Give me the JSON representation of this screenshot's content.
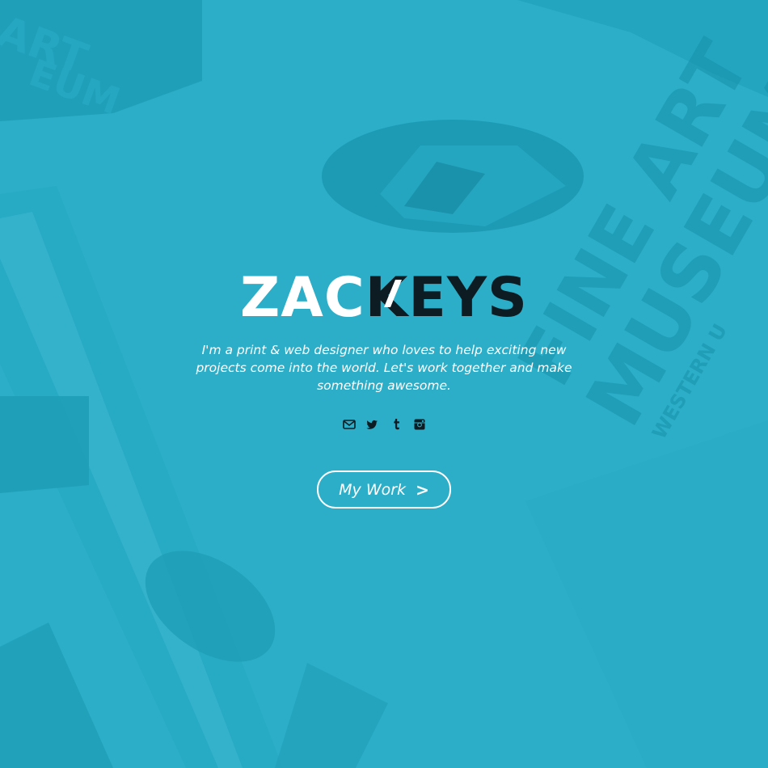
{
  "colors": {
    "background": "#2caec8",
    "background_art": "#1d9db7",
    "logo_light": "#ffffff",
    "logo_dark": "#0d1c22",
    "text": "#ffffff"
  },
  "logo": {
    "part1": "ZAC",
    "part2": "KEYS"
  },
  "hero": {
    "tagline": "I'm a print & web designer who loves to help exciting new projects come into the world. Let's work together and make something awesome."
  },
  "background": {
    "poster_text_1": "FINE ART",
    "poster_text_2": "MUSEUM",
    "poster_text_3": "WESTERN U",
    "corner_text_1": "ART",
    "corner_text_2": "EUM"
  },
  "social": [
    {
      "icon": "envelope-icon"
    },
    {
      "icon": "twitter-icon"
    },
    {
      "icon": "tumblr-icon"
    },
    {
      "icon": "instagram-icon"
    }
  ],
  "cta": {
    "label": "My Work",
    "chevron": ">"
  }
}
